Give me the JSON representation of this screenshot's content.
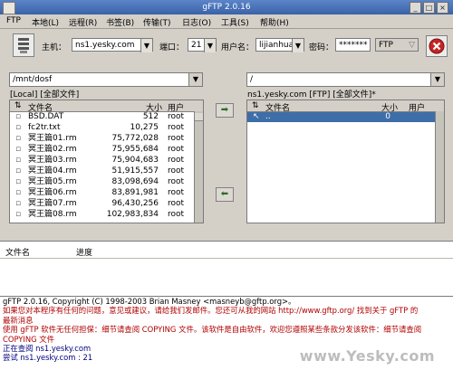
{
  "app": {
    "title": "gFTP 2.0.16"
  },
  "menu": [
    "FTP",
    "本地(L)",
    "远程(R)",
    "书签(B)",
    "传输(T)",
    "日志(O)",
    "工具(S)",
    "帮助(H)"
  ],
  "toolbar": {
    "host_label": "主机：",
    "host_value": "ns1.yesky.com",
    "port_label": "端口：",
    "port_value": "21",
    "user_label": "用户名：",
    "user_value": "lijianhua",
    "pass_label": "密码：",
    "pass_value": "*******",
    "protocol_value": "FTP"
  },
  "local": {
    "path": "/mnt/dosf",
    "status": "[Local] [全部文件]",
    "headers": {
      "name": "文件名",
      "size": "大小",
      "user": "用户"
    },
    "rows": [
      {
        "name": "BSD.DAT",
        "size": "512",
        "user": "root"
      },
      {
        "name": "fc2tr.txt",
        "size": "10,275",
        "user": "root"
      },
      {
        "name": "冥王篇01.rm",
        "size": "75,772,028",
        "user": "root"
      },
      {
        "name": "冥王篇02.rm",
        "size": "75,955,684",
        "user": "root"
      },
      {
        "name": "冥王篇03.rm",
        "size": "75,904,683",
        "user": "root"
      },
      {
        "name": "冥王篇04.rm",
        "size": "51,915,557",
        "user": "root"
      },
      {
        "name": "冥王篇05.rm",
        "size": "83,098,694",
        "user": "root"
      },
      {
        "name": "冥王篇06.rm",
        "size": "83,891,981",
        "user": "root"
      },
      {
        "name": "冥王篇07.rm",
        "size": "96,430,256",
        "user": "root"
      },
      {
        "name": "冥王篇08.rm",
        "size": "102,983,834",
        "user": "root"
      }
    ]
  },
  "remote": {
    "path": "/",
    "status": "ns1.yesky.com [FTP] [全部文件]*",
    "headers": {
      "name": "文件名",
      "size": "大小",
      "user": "用户"
    },
    "rows": [
      {
        "name": "..",
        "size": "0",
        "user": ""
      }
    ]
  },
  "transfers": {
    "col_file": "文件名",
    "col_progress": "进度"
  },
  "log": [
    "gFTP 2.0.16, Copyright (C) 1998-2003 Brian Masney <masneyb@gftp.org>。",
    "如果您对本程序有任何的问题，意见或建议，请给我们发邮件。您还可从我的网站 http://www.gftp.org/ 找到关于 gFTP 的",
    "最新消息",
    "使用 gFTP 软件无任何担保：细节请查阅 COPYING 文件。该软件是自由软件，欢迎您遵照某些条款分发该软件：细节请查阅",
    "COPYING 文件",
    "正在查阅 ns1.yesky.com",
    "尝试 ns1.yesky.com : 21"
  ],
  "watermark": "www.Yesky.com"
}
